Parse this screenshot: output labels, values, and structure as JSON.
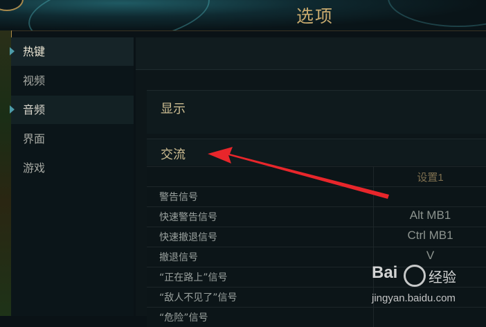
{
  "window": {
    "title": "选项"
  },
  "sidebar": {
    "items": [
      {
        "label": "热键"
      },
      {
        "label": "视频"
      },
      {
        "label": "音频"
      },
      {
        "label": "界面"
      },
      {
        "label": "游戏"
      }
    ]
  },
  "sections": {
    "display": "显示",
    "communication": "交流"
  },
  "table": {
    "column_header": "设置1",
    "rows": [
      {
        "label": "警告信号",
        "value": ""
      },
      {
        "label": "快速警告信号",
        "value": "Alt  MB1"
      },
      {
        "label": "快速撤退信号",
        "value": "Ctrl  MB1"
      },
      {
        "label": "撤退信号",
        "value": "V"
      },
      {
        "label": "“正在路上”信号",
        "value": ""
      },
      {
        "label": "“敌人不见了”信号",
        "value": ""
      },
      {
        "label": "“危险”信号",
        "value": ""
      }
    ]
  },
  "annotation": {
    "color": "#e8262b"
  },
  "watermark": {
    "logo": "Bai",
    "name": "经验",
    "url": "jingyan.baidu.com"
  },
  "colors": {
    "gold": "#c8aa6e",
    "accent": "#4d9ba8"
  }
}
